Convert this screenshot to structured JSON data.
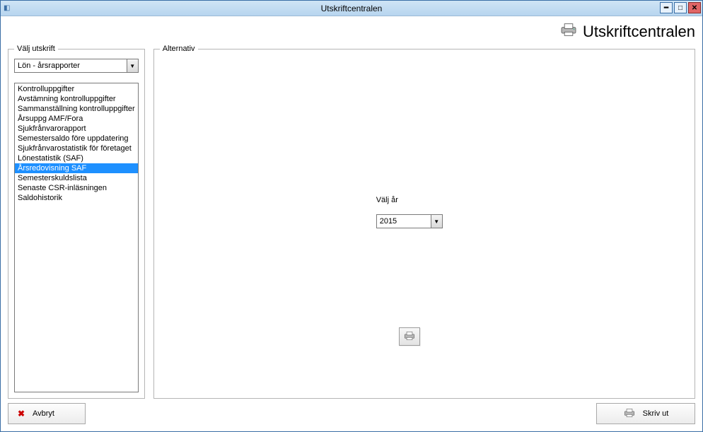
{
  "window": {
    "title": "Utskriftcentralen"
  },
  "header": {
    "title": "Utskriftcentralen"
  },
  "left": {
    "legend": "Välj utskrift",
    "dropdown_value": "Lön - årsrapporter",
    "items": [
      "Kontrolluppgifter",
      "Avstämning kontrolluppgifter",
      "Sammanställning kontrolluppgifter",
      "Årsuppg AMF/Fora",
      "Sjukfrånvarorapport",
      "Semestersaldo före uppdatering",
      "Sjukfrånvarostatistik för företaget",
      "Lönestatistik (SAF)",
      "Årsredovisning SAF",
      "Semesterskuldslista",
      "Senaste CSR-inläsningen",
      "Saldohistorik"
    ],
    "selected_index": 8
  },
  "right": {
    "legend": "Alternativ",
    "year_label": "Välj år",
    "year_value": "2015"
  },
  "footer": {
    "cancel_label": "Avbryt",
    "print_label": "Skriv ut"
  }
}
